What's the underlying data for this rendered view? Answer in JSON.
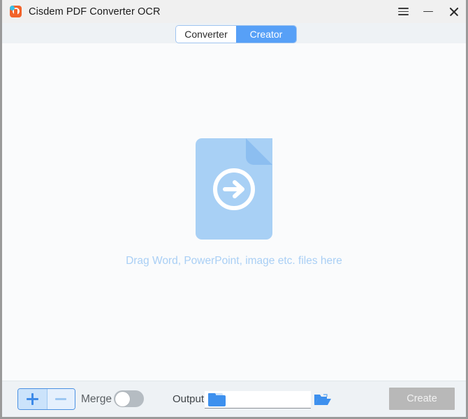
{
  "window": {
    "title": "Cisdem PDF Converter OCR",
    "app_icon": "cisdem-app-icon",
    "controls": {
      "menu": "hamburger-menu-icon",
      "minimize": "minimize-icon",
      "close": "close-icon"
    }
  },
  "tabs": [
    {
      "label": "Converter",
      "active": false
    },
    {
      "label": "Creator",
      "active": true
    }
  ],
  "main": {
    "drop_icon": "document-with-arrow-icon",
    "drop_text": "Drag Word, PowerPoint, image etc. files here"
  },
  "bottom": {
    "add_label": "+",
    "remove_label": "−",
    "merge_label": "Merge",
    "merge_enabled": false,
    "output_label": "Output",
    "output_value": "",
    "output_placeholder": "",
    "browse_icon": "open-folder-icon",
    "folder_icon": "folder-icon",
    "create_label": "Create",
    "create_enabled": false
  },
  "colors": {
    "accent_blue": "#57a0f7",
    "tab_border": "#9fc4f0",
    "drop_icon": "#a8d0f5",
    "drop_text": "#a9cff5",
    "titlebar_bg": "#f0f0f0",
    "band_bg": "#eef2f5",
    "main_bg": "#fafbfc",
    "disabled_gray": "#b8b8b8",
    "folder_blue": "#3d90ee",
    "app_icon_orange": "#f2632a"
  }
}
